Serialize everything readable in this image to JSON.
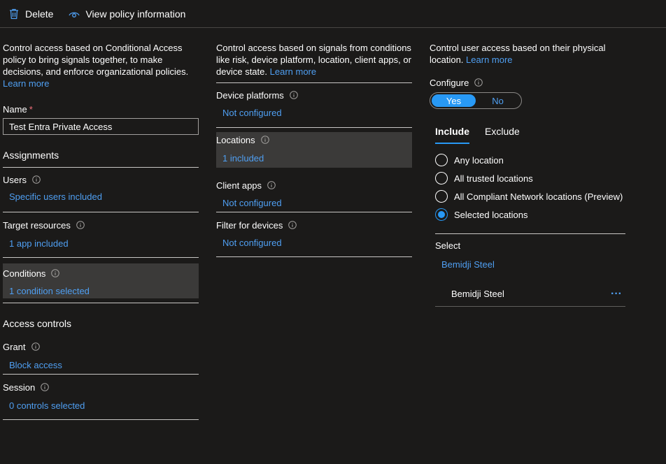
{
  "toolbar": {
    "delete_label": "Delete",
    "view_policy_label": "View policy information"
  },
  "left": {
    "description": "Control access based on Conditional Access policy to bring signals together, to make decisions, and enforce organizational policies.",
    "learn_more": "Learn more",
    "name_label": "Name",
    "required_mark": "*",
    "name_value": "Test Entra Private Access",
    "assignments_heading": "Assignments",
    "users_label": "Users",
    "users_value": "Specific users included",
    "target_label": "Target resources",
    "target_value": "1 app included",
    "conditions_label": "Conditions",
    "conditions_value": "1 condition selected",
    "access_heading": "Access controls",
    "grant_label": "Grant",
    "grant_value": "Block access",
    "session_label": "Session",
    "session_value": "0 controls selected"
  },
  "middle": {
    "description": "Control access based on signals from conditions like risk, device platform, location, client apps, or device state.",
    "learn_more": "Learn more",
    "device_platforms_label": "Device platforms",
    "device_platforms_value": "Not configured",
    "locations_label": "Locations",
    "locations_value": "1 included",
    "client_apps_label": "Client apps",
    "client_apps_value": "Not configured",
    "filter_label": "Filter for devices",
    "filter_value": "Not configured"
  },
  "right": {
    "description": "Control user access based on their physical location.",
    "learn_more": "Learn more",
    "configure_label": "Configure",
    "toggle_yes": "Yes",
    "toggle_no": "No",
    "tab_include": "Include",
    "tab_exclude": "Exclude",
    "radio_options": [
      "Any location",
      "All trusted locations",
      "All Compliant Network locations (Preview)",
      "Selected locations"
    ],
    "selected_radio_index": 3,
    "select_label": "Select",
    "select_link": "Bemidji Steel",
    "selected_item": "Bemidji Steel",
    "more_glyph": "···"
  },
  "colors": {
    "background": "#1b1a19",
    "link": "#4f9ff2",
    "accent": "#2899f5",
    "selected_row": "#3b3a39",
    "required": "#f1707b"
  },
  "icons": [
    "trash-icon",
    "eye-icon",
    "info-icon",
    "more-icon"
  ]
}
